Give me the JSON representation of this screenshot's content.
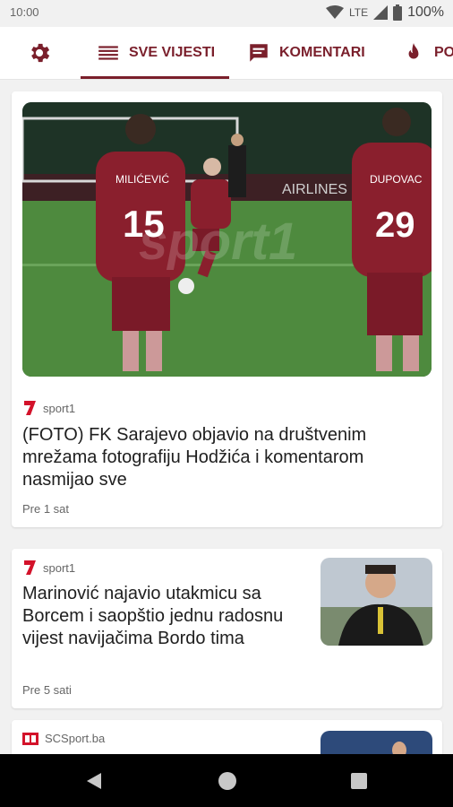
{
  "status_bar": {
    "time": "10:00",
    "network": "LTE",
    "battery": "100%",
    "icons": [
      "wifi-icon",
      "signal-icon",
      "battery-icon"
    ]
  },
  "tabs": [
    {
      "label": "SVE VIJESTI",
      "icon": "list-icon",
      "active": true
    },
    {
      "label": "KOMENTARI",
      "icon": "comment-icon",
      "active": false
    },
    {
      "label": "PO",
      "icon": "flame-icon",
      "active": false
    }
  ],
  "settings_icon": "gear-icon",
  "accent_color": "#7a1f2b",
  "articles": [
    {
      "source": "sport1",
      "title": "(FOTO) FK Sarajevo objavio na društvenim mrežama fotografiju Hodžića i komentarom nasmijao sve",
      "time": "Pre 1 sat",
      "image_text": {
        "jersey_left": "15",
        "jersey_right": "29",
        "name_left": "MILIĆEVIĆ",
        "name_right": "DUPOVAC",
        "banner": "AIRLINES",
        "watermark": "sport1"
      }
    },
    {
      "source": "sport1",
      "title": "Marinović najavio utakmicu sa Borcem i saopštio jednu radosnu vijest navijačima Bordo tima",
      "time": "Pre 5 sati"
    },
    {
      "source": "SCSport.ba",
      "title": "",
      "time": ""
    }
  ],
  "nav_bar": {
    "buttons": [
      "back-icon",
      "home-icon",
      "recents-icon"
    ]
  }
}
